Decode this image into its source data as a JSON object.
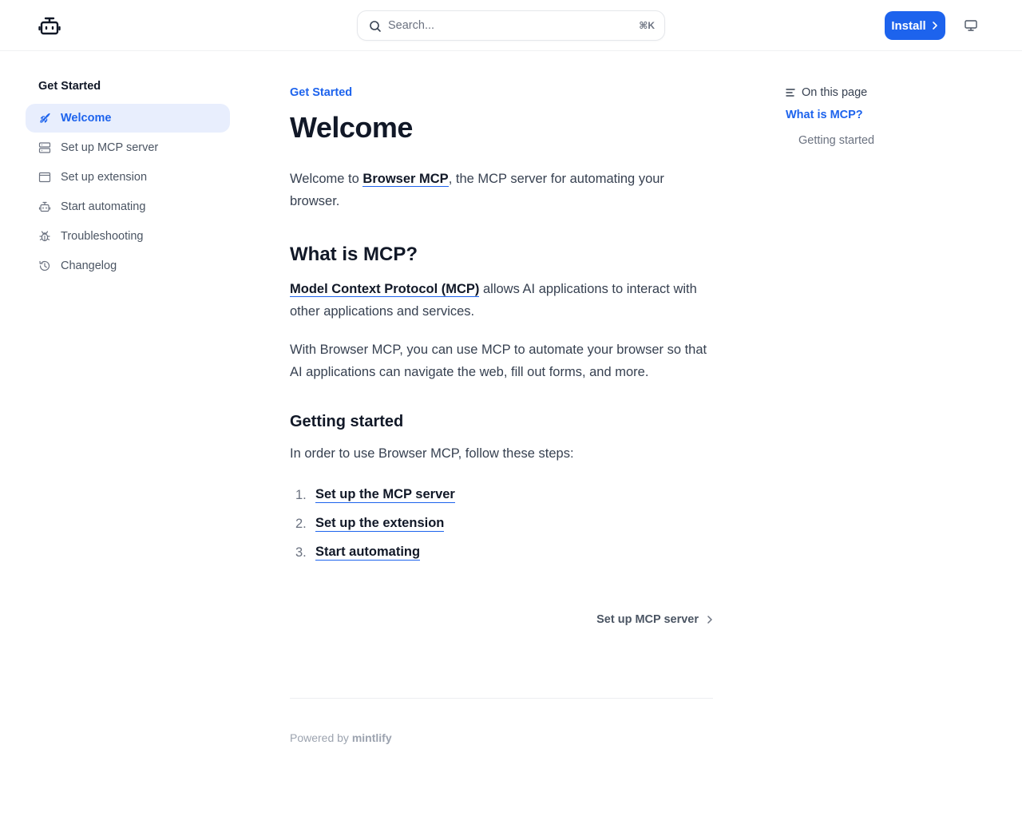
{
  "header": {
    "search_placeholder": "Search...",
    "search_shortcut": "⌘K",
    "install_label": "Install"
  },
  "sidebar": {
    "heading": "Get Started",
    "items": [
      {
        "label": "Welcome",
        "icon": "rocket-icon",
        "active": true
      },
      {
        "label": "Set up MCP server",
        "icon": "server-icon",
        "active": false
      },
      {
        "label": "Set up extension",
        "icon": "browser-window-icon",
        "active": false
      },
      {
        "label": "Start automating",
        "icon": "robot-icon",
        "active": false
      },
      {
        "label": "Troubleshooting",
        "icon": "bug-icon",
        "active": false
      },
      {
        "label": "Changelog",
        "icon": "history-icon",
        "active": false
      }
    ]
  },
  "main": {
    "eyebrow": "Get Started",
    "title": "Welcome",
    "intro": {
      "before": "Welcome to ",
      "link": "Browser MCP",
      "after": ", the MCP server for automating your browser."
    },
    "section1": {
      "heading": "What is MCP?",
      "p1_link": "Model Context Protocol (MCP)",
      "p1_after": " allows AI applications to interact with other applications and services.",
      "p2": "With Browser MCP, you can use MCP to automate your browser so that AI applications can navigate the web, fill out forms, and more."
    },
    "section2": {
      "heading": "Getting started",
      "intro": "In order to use Browser MCP, follow these steps:",
      "steps": [
        {
          "num": "1.",
          "label": "Set up the MCP server"
        },
        {
          "num": "2.",
          "label": "Set up the extension"
        },
        {
          "num": "3.",
          "label": "Start automating"
        }
      ]
    },
    "next_label": "Set up MCP server",
    "footer": {
      "powered_by": "Powered by",
      "brand": "mintlify"
    }
  },
  "toc": {
    "heading": "On this page",
    "items": [
      {
        "label": "What is MCP?",
        "active": true
      },
      {
        "label": "Getting started",
        "active": false
      }
    ]
  },
  "colors": {
    "accent": "#1d63ed",
    "active_bg": "#e8eefd",
    "heading": "#111827",
    "body": "#374151",
    "muted": "#6b7280"
  }
}
